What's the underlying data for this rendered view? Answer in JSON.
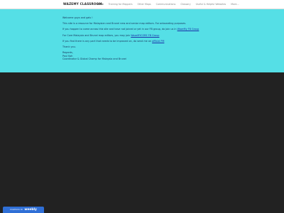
{
  "header": {
    "site_title": "WAZEMY CLASSROOM",
    "nav": [
      {
        "label": "Home",
        "active": true
      },
      {
        "label": "Training for Mappers"
      },
      {
        "label": "Other Maps"
      },
      {
        "label": "Communications"
      },
      {
        "label": "Glossary"
      },
      {
        "label": "Useful & Helpful Websites"
      },
      {
        "label": "More..."
      }
    ]
  },
  "content": {
    "background_color": "#55dfe6",
    "greeting": "Welcome guys and gals !",
    "p1": "This site is a resource for Malaysian and Brunei new and senior map editors. For onboarding purposes.",
    "p2_text": "If you happen to come across this site and have not joined or yet in our FB group, do join us in ",
    "p2_link": "WazeMy FB Group",
    "p3_text": "For Core Malaysia and Brunei map editors, you may join ",
    "p3_link": "WazeMYCORE FB Group",
    "p4_text": "If you find there is any part that needs to be improved on, do send me an ",
    "p4_link": "official PM",
    "thanks": "Thank you.",
    "sig_regards": "Regards,",
    "sig_name": "Paul Koh",
    "sig_role": "Coordinator & Global Champ for Malaysia and Brunei"
  },
  "footer": {
    "badge_small": "POWERED BY",
    "badge_brand": "weebly"
  }
}
